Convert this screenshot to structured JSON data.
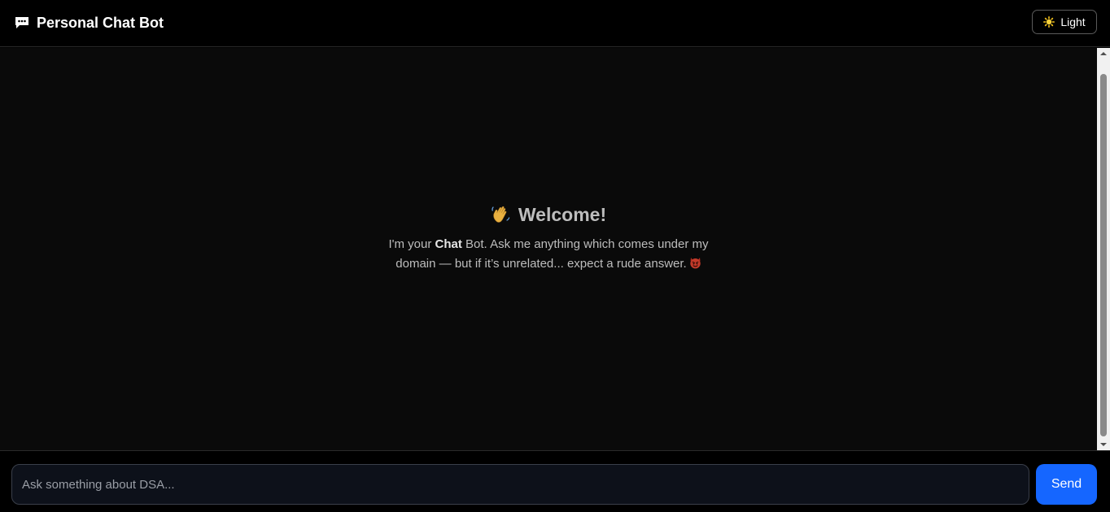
{
  "header": {
    "title": "Personal Chat Bot",
    "brand_icon": "chat-icon",
    "theme_toggle": {
      "label": "Light",
      "icon": "sun-icon"
    }
  },
  "welcome": {
    "emoji_icon": "waving-hand-icon",
    "title": "Welcome!",
    "text_prefix": "I'm your ",
    "text_bold": "Chat",
    "text_suffix": " Bot. Ask me anything which comes under my domain — but if it’s unrelated... expect a rude answer.",
    "end_emoji_icon": "devil-face-icon"
  },
  "composer": {
    "placeholder": "Ask something about DSA...",
    "value": "",
    "send_label": "Send"
  },
  "colors": {
    "background": "#000000",
    "chat_background": "#0a0a0a",
    "accent": "#1566ff",
    "text_muted": "#bdbdbd"
  }
}
